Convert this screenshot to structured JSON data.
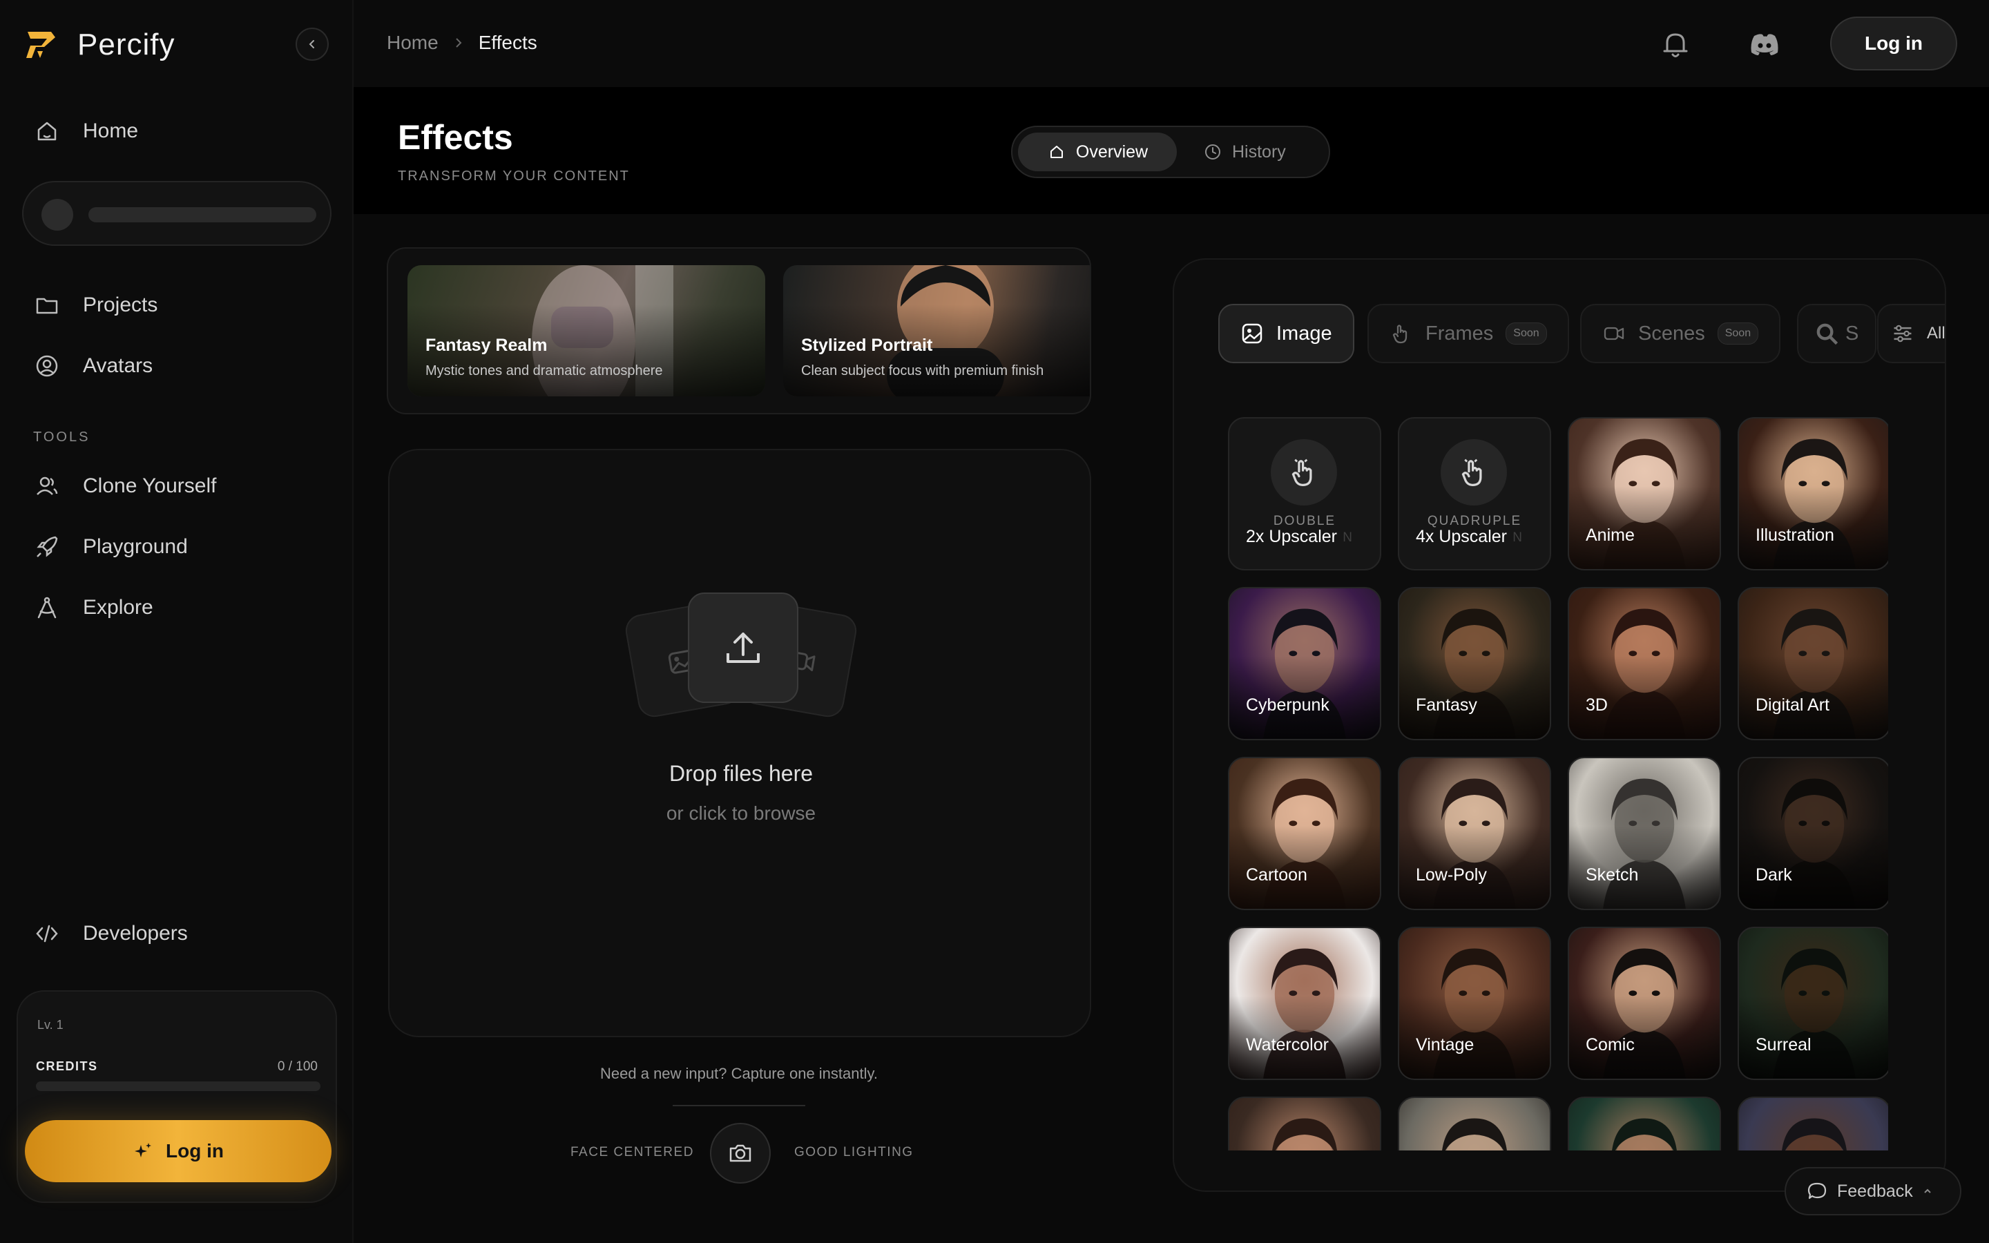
{
  "app": {
    "name": "Percify"
  },
  "sidebar": {
    "collapse_icon": "chevron-left-icon",
    "nav_home": "Home",
    "nav_projects": "Projects",
    "nav_avatars": "Avatars",
    "tools_label": "TOOLS",
    "tools": [
      {
        "label": "Clone Yourself",
        "icon": "user-clone-icon"
      },
      {
        "label": "Playground",
        "icon": "rocket-icon"
      },
      {
        "label": "Explore",
        "icon": "compass-icon"
      }
    ],
    "nav_developers": "Developers",
    "credits_card": {
      "level": "Lv. 1",
      "credits_label": "CREDITS",
      "credits_value": "0 / 100",
      "credits_progress_pct": 0,
      "login_label": "Log in"
    }
  },
  "topbar": {
    "breadcrumb_home": "Home",
    "breadcrumb_current": "Effects",
    "login_label": "Log in"
  },
  "header": {
    "title": "Effects",
    "subtitle": "TRANSFORM YOUR CONTENT",
    "tabs": {
      "overview": "Overview",
      "history": "History"
    }
  },
  "banners": [
    {
      "title": "Fantasy Realm",
      "subtitle": "Mystic tones and dramatic atmosphere"
    },
    {
      "title": "Stylized Portrait",
      "subtitle": "Clean subject focus with premium finish"
    }
  ],
  "dropzone": {
    "title": "Drop files here",
    "subtitle": "or click to browse"
  },
  "capture": {
    "prompt": "Need a new input? Capture one instantly.",
    "left_hint": "FACE CENTERED",
    "right_hint": "GOOD LIGHTING"
  },
  "effects_panel": {
    "tabs": {
      "image": "Image",
      "frames": "Frames",
      "scenes": "Scenes",
      "soon": "Soon",
      "search_letter": "S",
      "filter_all": "All"
    },
    "upscalers": [
      {
        "label": "2x Upscaler",
        "kind": "DOUBLE",
        "kind2": "N"
      },
      {
        "label": "4x Upscaler",
        "kind": "QUADRUPLE",
        "kind2": "N"
      }
    ],
    "styles": [
      "Anime",
      "Illustration",
      "Cyberpunk",
      "Fantasy",
      "3D",
      "Digital Art",
      "Cartoon",
      "Low-Poly",
      "Sketch",
      "Dark",
      "Watercolor",
      "Vintage",
      "Comic",
      "Surreal"
    ]
  },
  "feedback_label": "Feedback",
  "colors": {
    "accent": "#f2b43a",
    "background": "#050505"
  }
}
